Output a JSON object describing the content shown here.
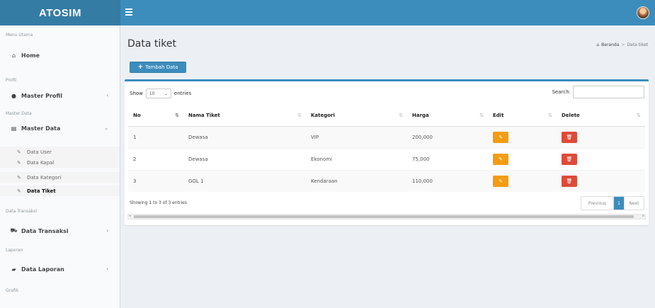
{
  "app": {
    "logo": "ATOSIM"
  },
  "sidebar": {
    "header_menu": "Menu Utama",
    "home": "Home",
    "header_profil": "Profil",
    "master_profil": "Master Profil",
    "header_master": "Master Data",
    "master_data": "Master Data",
    "sub": [
      "Data User",
      "Data Kapal",
      "Data Kategori",
      "Data Tiket"
    ],
    "header_transaksi": "Data Transaksi",
    "data_transaksi": "Data Transaksi",
    "header_laporan": "Laporan",
    "data_laporan": "Data Laporan",
    "header_grafik": "Grafik"
  },
  "page": {
    "title": "Data tiket",
    "breadcrumb": [
      "Beranda",
      "Data tiket"
    ],
    "add_button": "Tambah Data"
  },
  "table": {
    "show_label": "Show",
    "entries_value": "10",
    "entries_label": "entries",
    "search_label": "Search:",
    "columns": [
      "No",
      "Nama Tiket",
      "Kategori",
      "Harga",
      "Edit",
      "Delete"
    ],
    "rows": [
      [
        "1",
        "Dewasa",
        "VIP",
        "200,000"
      ],
      [
        "2",
        "Dewasa",
        "Ekonomi",
        "75,000"
      ],
      [
        "3",
        "GOL 1",
        "Kendaraan",
        "110,000"
      ]
    ],
    "info": "Showing 1 to 3 of 3 entries",
    "pager": {
      "previous": "Previous",
      "page": "1",
      "next": "Next"
    }
  },
  "colors": {
    "header": "#3c8dbc",
    "logo_bg": "#357ca5",
    "edit": "#f39c12",
    "delete": "#dd4b39"
  }
}
